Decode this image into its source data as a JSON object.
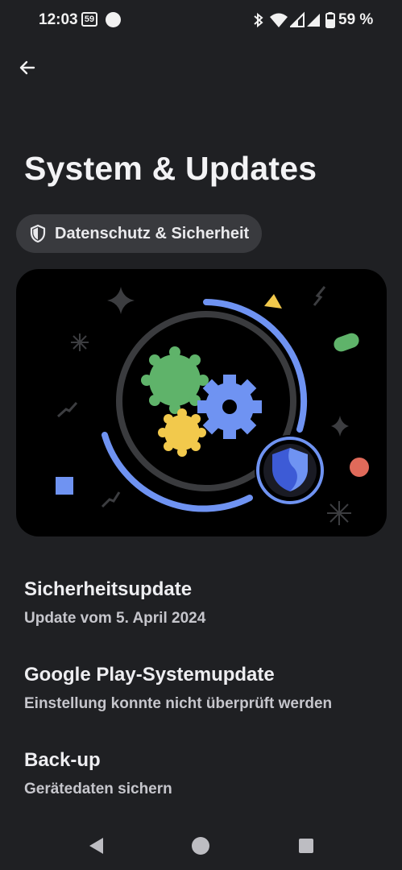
{
  "status_bar": {
    "time": "12:03",
    "notification_badge": "59",
    "battery_percent": "59 %",
    "icons": [
      "bluetooth-icon",
      "wifi-icon",
      "signal-icon",
      "signal-icon",
      "battery-icon"
    ]
  },
  "header": {
    "back_icon": "arrow-left-icon",
    "title": "System & Updates"
  },
  "chip": {
    "icon": "shield-icon",
    "label": "Datenschutz & Sicherheit"
  },
  "items": [
    {
      "title": "Sicherheitsupdate",
      "subtitle": "Update vom 5. April 2024"
    },
    {
      "title": "Google Play-Systemupdate",
      "subtitle": "Einstellung konnte nicht überprüft werden"
    },
    {
      "title": "Back-up",
      "subtitle": "Gerätedaten sichern"
    }
  ],
  "nav_bar": {
    "back_icon": "triangle-back-icon",
    "home_icon": "circle-home-icon",
    "recents_icon": "square-recents-icon"
  },
  "colors": {
    "background": "#1f2023",
    "chip_bg": "#393a3e",
    "accent_blue": "#6f93f2",
    "green": "#5fb36a",
    "yellow": "#f2c94c",
    "red": "#e06a5a"
  }
}
